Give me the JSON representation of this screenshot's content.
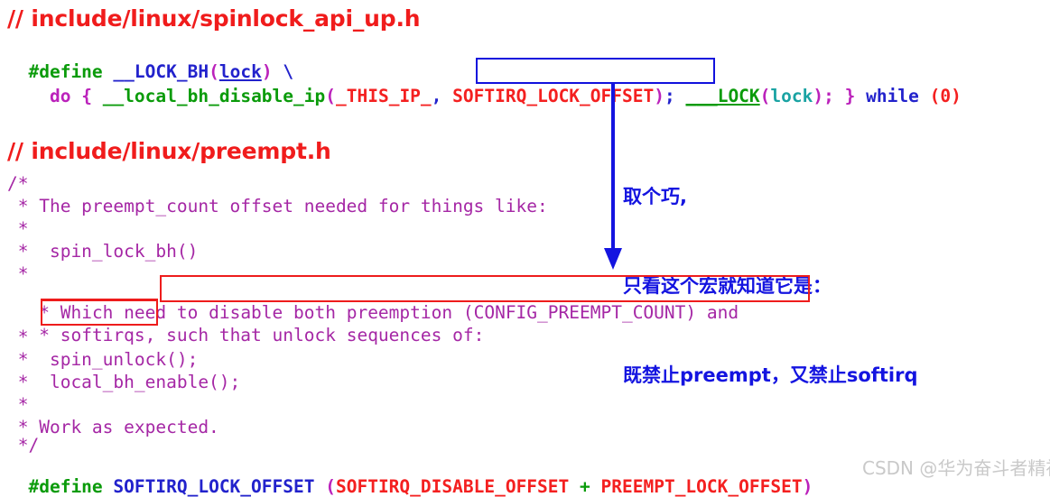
{
  "section1": {
    "title": "// include/linux/spinlock_api_up.h",
    "line1": {
      "define": "#define",
      "macro": "__LOCK_BH",
      "paren_open": "(",
      "arg": "lock",
      "paren_close": ")",
      "backslash": "\\"
    },
    "line2": {
      "do": "do",
      "brace_open": "{",
      "fn": "__local_bh_disable_ip",
      "paren_open": "(",
      "arg1": "_THIS_IP_",
      "comma": ",",
      "highlighted_arg": "SOFTIRQ_LOCK_OFFSET",
      "paren_close": ")",
      "semi1": ";",
      "fn2": "___LOCK",
      "paren_open2": "(",
      "arg2": "lock",
      "paren_close2": ")",
      "semi2": ";",
      "brace_close": "}",
      "while": "while",
      "cond": "(0)"
    }
  },
  "section2": {
    "title": "// include/linux/preempt.h",
    "comment_lines": [
      "/*",
      " * The preempt_count offset needed for things like:",
      " *",
      " *  spin_lock_bh()",
      " *"
    ],
    "boxed_line_a_prefix": " * ",
    "boxed_line_a_underlined": "Which need to ",
    "boxed_line_a_boxed": "disable both preemption (CONFIG_PREEMPT_COUNT) and",
    "boxed_line_b_prefix": " * ",
    "boxed_line_b_boxed": "softirqs,",
    "boxed_line_b_suffix": " such that unlock sequences of:",
    "comment_lines_tail": [
      " *",
      " *  spin_unlock();",
      " *  local_bh_enable();",
      " *",
      " * Work as expected.",
      " */"
    ],
    "define_line": {
      "define": "#define",
      "name": "SOFTIRQ_LOCK_OFFSET",
      "paren_open": "(",
      "operand1": "SOFTIRQ_DISABLE_OFFSET",
      "operator": "+",
      "operand2": "PREEMPT_LOCK_OFFSET",
      "paren_close": ")"
    }
  },
  "annotation": {
    "note_lines": [
      "取个巧,",
      "只看这个宏就知道它是：",
      "既禁止preempt，又禁止softirq"
    ],
    "arrow_color": "#1414e0",
    "blue_box_color": "#1111dd",
    "red_box_color": "#ee1c1c"
  },
  "watermark": {
    "text": "CSDN @华为奋斗者精神"
  }
}
